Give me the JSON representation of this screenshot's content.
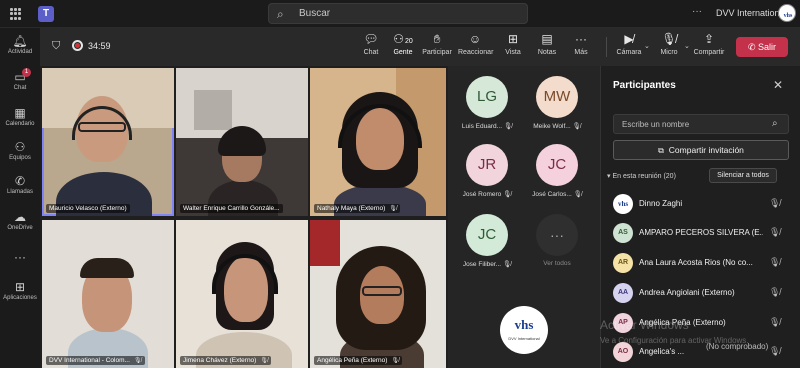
{
  "titlebar": {
    "search_placeholder": "Buscar",
    "more": "···",
    "org_name": "DVV International"
  },
  "rail": [
    {
      "label": "Actividad",
      "icon": "bell-icon"
    },
    {
      "label": "Chat",
      "icon": "chat-icon",
      "badge": "1"
    },
    {
      "label": "Calendario",
      "icon": "calendar-icon"
    },
    {
      "label": "Equipos",
      "icon": "teams-icon"
    },
    {
      "label": "Llamadas",
      "icon": "phone-icon"
    },
    {
      "label": "OneDrive",
      "icon": "cloud-icon"
    },
    {
      "label": "···",
      "icon": "more-icon"
    },
    {
      "label": "Aplicaciones",
      "icon": "apps-icon"
    }
  ],
  "toolbar": {
    "timer": "34:59",
    "chat": "Chat",
    "people": "Gente",
    "people_count": "20",
    "raise": "Participar",
    "react": "Reaccionar",
    "view": "Vista",
    "notes": "Notas",
    "more": "Más",
    "camera": "Cámara",
    "mic": "Micro",
    "share": "Compartir",
    "leave": "Salir"
  },
  "videos": [
    {
      "name": "Mauricio Velasco (Externo)"
    },
    {
      "name": "Walter Enrique Carrillo Gonzále..."
    },
    {
      "name": "Nathaly Maya (Externo)"
    },
    {
      "name": "DVV International - Colom..."
    },
    {
      "name": "Jimena Chávez (Externo)"
    },
    {
      "name": "Angélica Peña (Externo)"
    }
  ],
  "gallery": [
    {
      "initials": "LG",
      "label": "Luis Eduard...",
      "bg": "#d6e8d8",
      "fg": "#2f5a36"
    },
    {
      "initials": "MW",
      "label": "Meike Wolf...",
      "bg": "#f3dccb",
      "fg": "#7a4a2a"
    },
    {
      "initials": "JR",
      "label": "José Romero",
      "bg": "#f1d4dc",
      "fg": "#7a2e45"
    },
    {
      "initials": "JC",
      "label": "José Carlos...",
      "bg": "#f4d1dc",
      "fg": "#7a2e45"
    },
    {
      "initials": "JC",
      "label": "Jose Filiber...",
      "bg": "#d3ead9",
      "fg": "#2f5a36"
    },
    {
      "initials": "···",
      "label": "Ver todos"
    }
  ],
  "panel": {
    "title": "Participantes",
    "search_placeholder": "Escribe un nombre",
    "share_invite": "Compartir invitación",
    "section": "En esta reunión (20)",
    "mute_all": "Silenciar a todos",
    "participants": [
      {
        "initials": "vhs",
        "name": "Dinno Zaghi",
        "bg": "#ffffff",
        "fg": "#1d3d8f"
      },
      {
        "initials": "AS",
        "name": "AMPARO PECEROS SILVERA (E...",
        "bg": "#cfe3d2",
        "fg": "#2f5a36"
      },
      {
        "initials": "AR",
        "name": "Ana Laura Acosta Rios (No co...",
        "bg": "#f5e2a6",
        "fg": "#6b5512"
      },
      {
        "initials": "AA",
        "name": "Andrea Angiolani (Externo)",
        "bg": "#d6d3f0",
        "fg": "#3b3578"
      },
      {
        "initials": "AP",
        "name": "Angélica Peña (Externo)",
        "bg": "#f0d3dc",
        "fg": "#7a2e45"
      },
      {
        "initials": "AO",
        "name": "Angelica's ...",
        "bg": "#f2d3d8",
        "fg": "#7a2e45"
      }
    ],
    "unverified": "(No comprobado)"
  },
  "watermark": {
    "line1": "Activar Windows",
    "line2": "Ve a Configuración para activar Windows."
  }
}
